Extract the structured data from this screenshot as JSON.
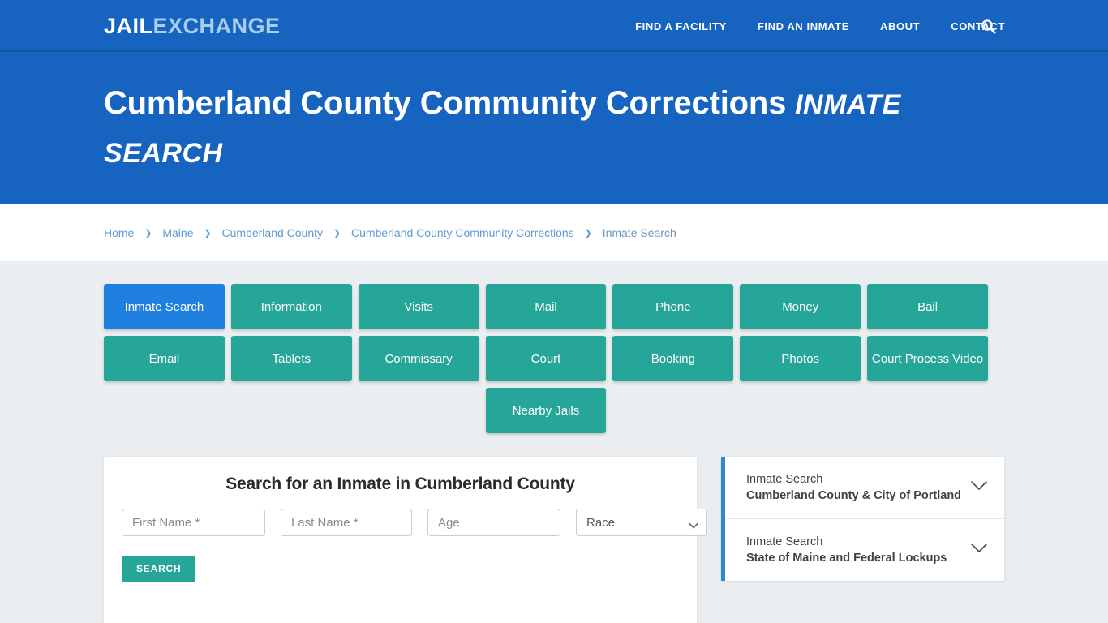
{
  "header": {
    "logo_primary": "JAIL",
    "logo_secondary": "EXCHANGE",
    "nav": [
      {
        "label": "FIND A FACILITY"
      },
      {
        "label": "FIND AN INMATE"
      },
      {
        "label": "ABOUT"
      },
      {
        "label": "CONTACT"
      }
    ],
    "search_icon": "search-icon"
  },
  "hero": {
    "title_main": "Cumberland County Community Corrections ",
    "title_italic": "INMATE SEARCH"
  },
  "breadcrumb": {
    "items": [
      {
        "label": "Home",
        "current": false
      },
      {
        "label": "Maine",
        "current": false
      },
      {
        "label": "Cumberland County",
        "current": false
      },
      {
        "label": "Cumberland County Community Corrections",
        "current": false
      },
      {
        "label": "Inmate Search",
        "current": true
      }
    ],
    "separator": "❯"
  },
  "tiles": [
    {
      "label": "Inmate Search",
      "active": true
    },
    {
      "label": "Information",
      "active": false
    },
    {
      "label": "Visits",
      "active": false
    },
    {
      "label": "Mail",
      "active": false
    },
    {
      "label": "Phone",
      "active": false
    },
    {
      "label": "Money",
      "active": false
    },
    {
      "label": "Bail",
      "active": false
    },
    {
      "label": "Email",
      "active": false
    },
    {
      "label": "Tablets",
      "active": false
    },
    {
      "label": "Commissary",
      "active": false
    },
    {
      "label": "Court",
      "active": false
    },
    {
      "label": "Booking",
      "active": false
    },
    {
      "label": "Photos",
      "active": false
    },
    {
      "label": "Court Process Video",
      "active": false
    },
    {
      "label": "Nearby Jails",
      "active": false
    }
  ],
  "search_form": {
    "heading": "Search for an Inmate in Cumberland County",
    "first_name_placeholder": "First Name *",
    "first_name_value": "",
    "last_name_placeholder": "Last Name *",
    "last_name_value": "",
    "age_placeholder": "Age",
    "age_value": "",
    "race_selected": "Race",
    "submit_label": "SEARCH"
  },
  "sidebar": {
    "panels": [
      {
        "line1": "Inmate Search",
        "line2": "Cumberland County & City of Portland",
        "icon": "chevron-down-icon"
      },
      {
        "line1": "Inmate Search",
        "line2": "State of Maine and Federal Lockups",
        "icon": "chevron-down-icon"
      }
    ]
  },
  "colors": {
    "header_blue": "#1764c0",
    "accent_teal": "#26a699",
    "active_blue": "#2080e0",
    "page_bg": "#ebeef0",
    "link_blue": "#5a9bd8",
    "sidebar_accent": "#2f87d9"
  }
}
